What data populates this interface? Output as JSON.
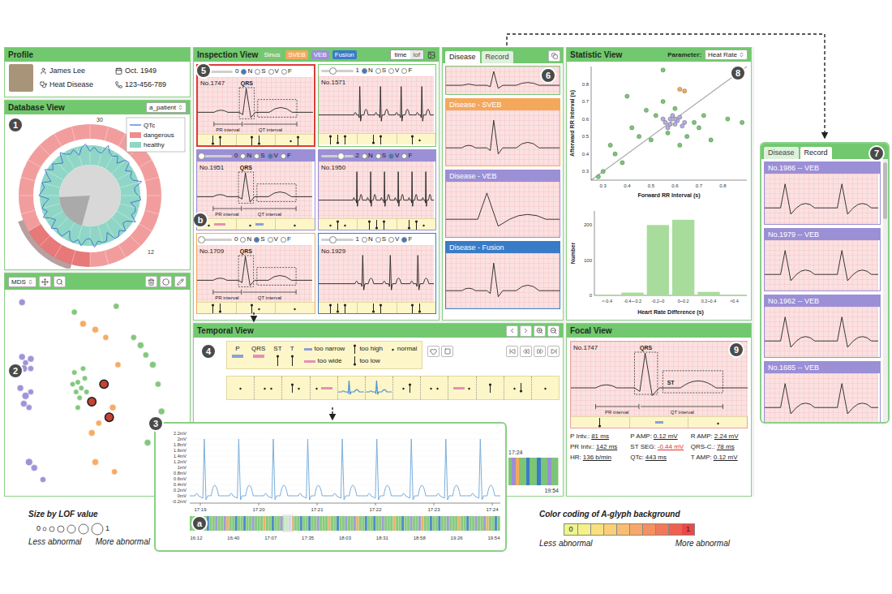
{
  "profile": {
    "title": "Profile",
    "name": "James Lee",
    "birth": "Oct. 1949",
    "disease": "Heat Disease",
    "phone": "123-456-789"
  },
  "database": {
    "title": "Database View",
    "badge": "1",
    "select": "a_patient",
    "legend": [
      {
        "label": "QTc",
        "color": "#3b6fd1"
      },
      {
        "label": "dangerous",
        "color": "#f08c8c"
      },
      {
        "label": "healthy",
        "color": "#8fd6c6"
      }
    ],
    "ticks": [
      "30",
      "12"
    ]
  },
  "projection": {
    "badge": "2",
    "select": "MDS",
    "points": [
      [
        8,
        32,
        0.5,
        "#9b8fd6"
      ],
      [
        10,
        35,
        0.4,
        "#9b8fd6"
      ],
      [
        13,
        33,
        0.5,
        "#9b8fd6"
      ],
      [
        9,
        38,
        0.6,
        "#9b8fd6"
      ],
      [
        13,
        38,
        0.4,
        "#9b8fd6"
      ],
      [
        7,
        48,
        0.5,
        "#9b8fd6"
      ],
      [
        10,
        52,
        0.6,
        "#9b8fd6"
      ],
      [
        13,
        50,
        0.4,
        "#9b8fd6"
      ],
      [
        9,
        56,
        0.5,
        "#9b8fd6"
      ],
      [
        12,
        58,
        0.4,
        "#9b8fd6"
      ],
      [
        12,
        86,
        0.6,
        "#9b8fd6"
      ],
      [
        15,
        89,
        0.5,
        "#9b8fd6"
      ],
      [
        20,
        95,
        0.4,
        "#9b8fd6"
      ],
      [
        8,
        4,
        0.5,
        "#9b8fd6"
      ],
      [
        38,
        40,
        0.3,
        "#7cc576"
      ],
      [
        40,
        45,
        0.3,
        "#7cc576"
      ],
      [
        42,
        48,
        0.3,
        "#7cc576"
      ],
      [
        39,
        50,
        0.3,
        "#7cc576"
      ],
      [
        44,
        43,
        0.3,
        "#7cc576"
      ],
      [
        41,
        53,
        0.3,
        "#7cc576"
      ],
      [
        37,
        46,
        0.3,
        "#7cc576"
      ],
      [
        43,
        38,
        0.3,
        "#7cc576"
      ],
      [
        45,
        50,
        0.3,
        "#7cc576"
      ],
      [
        40,
        58,
        0.3,
        "#7cc576"
      ],
      [
        72,
        22,
        0.4,
        "#7cc576"
      ],
      [
        76,
        26,
        0.5,
        "#7cc576"
      ],
      [
        79,
        31,
        0.4,
        "#7cc576"
      ],
      [
        83,
        36,
        0.5,
        "#7cc576"
      ],
      [
        86,
        46,
        0.4,
        "#7cc576"
      ],
      [
        88,
        60,
        0.5,
        "#7cc576"
      ],
      [
        85,
        69,
        0.4,
        "#7cc576"
      ],
      [
        80,
        76,
        0.5,
        "#7cc576"
      ],
      [
        62,
        6,
        0.4,
        "#7cc576"
      ],
      [
        38,
        9,
        0.4,
        "#7cc576"
      ],
      [
        43,
        15,
        0.5,
        "#f5a85c"
      ],
      [
        50,
        18,
        0.5,
        "#f5a85c"
      ],
      [
        56,
        22,
        0.4,
        "#f5a85c"
      ],
      [
        60,
        58,
        0.5,
        "#f5a85c"
      ],
      [
        52,
        66,
        0.4,
        "#f5a85c"
      ],
      [
        48,
        71,
        0.5,
        "#f5a85c"
      ],
      [
        63,
        36,
        0.4,
        "#f5a85c"
      ],
      [
        50,
        86,
        0.5,
        "#f5a85c"
      ],
      [
        61,
        91,
        0.4,
        "#f5a85c"
      ],
      [
        55,
        46,
        0.8,
        "#c0392b"
      ],
      [
        48,
        55,
        0.8,
        "#c0392b"
      ],
      [
        58,
        63,
        0.8,
        "#c0392b"
      ]
    ]
  },
  "inspection": {
    "title": "Inspection View",
    "badge": "5",
    "glyph_badge": "b",
    "tags": [
      {
        "label": "Sinus",
        "color": "#7cc576"
      },
      {
        "label": "SVEB",
        "color": "#f5a85c"
      },
      {
        "label": "VEB",
        "color": "#9b8fd6"
      },
      {
        "label": "Fusion",
        "color": "#3a7bc8"
      }
    ],
    "modes": [
      {
        "label": "time",
        "selected": true
      },
      {
        "label": "lof",
        "selected": false
      }
    ],
    "classes": [
      "N",
      "S",
      "V",
      "F"
    ],
    "cards": [
      {
        "id": "No.1747",
        "value": "0",
        "level": 0.06,
        "class": "N",
        "border": "#e03a3a",
        "header": "#ffffff",
        "wave": "normal",
        "beats": 1,
        "labels": [
          "QRS",
          "PR interval",
          "QT interval"
        ],
        "glyphs": [
          [
            "low",
            "high"
          ],
          [
            "high",
            "low"
          ],
          [
            "normal",
            "high"
          ]
        ],
        "focused": true
      },
      {
        "id": "No.1571",
        "value": "1",
        "level": 0.35,
        "class": "N",
        "border": "#7cc576",
        "header": "#ffffff",
        "wave": "normal",
        "beats": 4,
        "labels": [],
        "glyphs": [
          [
            "high",
            "low",
            "high"
          ],
          [
            "low",
            "high"
          ],
          [
            "high",
            "normal"
          ]
        ],
        "focused": false
      },
      {
        "id": "No.1951",
        "value": "0",
        "level": 0.06,
        "class": "V",
        "border": "#9b8fd6",
        "header": "#9b8fd6",
        "wave": "normal",
        "beats": 1,
        "labels": [
          "QRS",
          "PR interval",
          "QT interval"
        ],
        "glyphs": [
          [
            "normal",
            "wide"
          ],
          [
            "normal",
            "narrow"
          ],
          [
            "normal"
          ]
        ],
        "focused": false
      },
      {
        "id": "No.1950",
        "value": "2",
        "level": 0.62,
        "class": "V",
        "border": "#9b8fd6",
        "header": "#9b8fd6",
        "wave": "normal",
        "beats": 6,
        "labels": [],
        "glyphs": [
          [
            "normal",
            "high",
            "normal"
          ],
          [
            "high",
            "low",
            "high"
          ],
          [
            "low",
            "high",
            "normal"
          ]
        ],
        "focused": false
      },
      {
        "id": "No.1709",
        "value": "0",
        "level": 0.06,
        "class": "S",
        "border": "#f5a85c",
        "header": "#ffffff",
        "wave": "normal",
        "beats": 1,
        "labels": [
          "QRS",
          "PR interval",
          "QT interval"
        ],
        "glyphs": [
          [
            "high",
            "low"
          ],
          [
            "high",
            "normal"
          ],
          [
            "normal"
          ]
        ],
        "focused": false
      },
      {
        "id": "No.1929",
        "value": "1",
        "level": 0.35,
        "class": "F",
        "border": "#3a7bc8",
        "header": "#ffffff",
        "wave": "normal",
        "beats": 3,
        "labels": [],
        "glyphs": [
          [
            "high",
            "low",
            "high"
          ],
          [
            "low",
            "high"
          ],
          [
            "high",
            "low"
          ]
        ],
        "focused": false
      }
    ]
  },
  "disease": {
    "badge": "6",
    "tabs": [
      {
        "label": "Disease",
        "selected": true
      },
      {
        "label": "Record",
        "selected": false
      }
    ],
    "clipped": {
      "color": "#7cc576",
      "wave": "normal"
    },
    "items": [
      {
        "label": "Disease - SVEB",
        "color": "#f5a85c",
        "wave": "normal"
      },
      {
        "label": "Disease - VEB",
        "color": "#9b8fd6",
        "wave": "veb"
      },
      {
        "label": "Disease - Fusion",
        "color": "#3a7bc8",
        "wave": "normal"
      }
    ]
  },
  "statistic": {
    "title": "Statistic View",
    "badge": "8",
    "param_label": "Parameter:",
    "param": "Heat Rate",
    "scatter": {
      "x_title": "Forward RR Interval (s)",
      "y_title": "Afterward RR Interval (s)",
      "x_ticks": [
        "0.3",
        "0.4",
        "0.5",
        "0.6",
        "0.7",
        "0.8"
      ],
      "y_ticks": [
        "0.3",
        "0.4",
        "0.5",
        "0.6",
        "0.7",
        "0.8"
      ],
      "points": [
        [
          0.28,
          0.27,
          "#7cc576"
        ],
        [
          0.3,
          0.3,
          "#7cc576"
        ],
        [
          0.33,
          0.45,
          "#7cc576"
        ],
        [
          0.35,
          0.4,
          "#7cc576"
        ],
        [
          0.4,
          0.73,
          "#7cc576"
        ],
        [
          0.42,
          0.55,
          "#7cc576"
        ],
        [
          0.45,
          0.5,
          "#7cc576"
        ],
        [
          0.48,
          0.65,
          "#7cc576"
        ],
        [
          0.5,
          0.48,
          "#7cc576"
        ],
        [
          0.52,
          0.62,
          "#7cc576"
        ],
        [
          0.55,
          0.7,
          "#7cc576"
        ],
        [
          0.57,
          0.52,
          "#7cc576"
        ],
        [
          0.62,
          0.45,
          "#7cc576"
        ],
        [
          0.65,
          0.5,
          "#7cc576"
        ],
        [
          0.68,
          0.58,
          "#7cc576"
        ],
        [
          0.7,
          0.55,
          "#7cc576"
        ],
        [
          0.72,
          0.62,
          "#7cc576"
        ],
        [
          0.75,
          0.48,
          "#7cc576"
        ],
        [
          0.82,
          0.6,
          "#7cc576"
        ],
        [
          0.88,
          0.58,
          "#7cc576"
        ],
        [
          0.55,
          0.88,
          "#7cc576"
        ],
        [
          0.38,
          0.35,
          "#7cc576"
        ],
        [
          0.6,
          0.66,
          "#7cc576"
        ],
        [
          0.56,
          0.58,
          "#b9a8e6"
        ],
        [
          0.58,
          0.6,
          "#b9a8e6"
        ],
        [
          0.6,
          0.57,
          "#b9a8e6"
        ],
        [
          0.59,
          0.62,
          "#b9a8e6"
        ],
        [
          0.61,
          0.59,
          "#b9a8e6"
        ],
        [
          0.57,
          0.55,
          "#b9a8e6"
        ],
        [
          0.62,
          0.61,
          "#b9a8e6"
        ],
        [
          0.63,
          0.56,
          "#b9a8e6"
        ],
        [
          0.6,
          0.6,
          "#b9a8e6"
        ],
        [
          0.58,
          0.57,
          "#b9a8e6"
        ],
        [
          0.55,
          0.6,
          "#b9a8e6"
        ],
        [
          0.64,
          0.58,
          "#b9a8e6"
        ],
        [
          0.62,
          0.77,
          "#f5a85c"
        ],
        [
          0.64,
          0.76,
          "#f5a85c"
        ]
      ]
    },
    "histogram": {
      "x_title": "Heart Rate Difference (s)",
      "y_title": "Number",
      "y_ticks": [
        "0",
        "100",
        "200"
      ],
      "categories": [
        "<-0.4",
        "-0.4~-0.2",
        "-0.2~0",
        "0~0.2",
        "0.2~0.4",
        ">0.4"
      ],
      "values": [
        2,
        8,
        200,
        215,
        10,
        2
      ],
      "color": "#a8dc9c"
    }
  },
  "temporal": {
    "title": "Temporal View",
    "badge": "4",
    "parts": [
      {
        "label": "P",
        "kind": "bar",
        "color": "#8aa0d8"
      },
      {
        "label": "QRS",
        "kind": "bar",
        "color": "#e58fb8"
      },
      {
        "label": "ST",
        "kind": "high",
        "color": "#222222"
      },
      {
        "label": "T",
        "kind": "high",
        "color": "#222222"
      }
    ],
    "marks": [
      {
        "label": "too narrow",
        "kind": "narrow"
      },
      {
        "label": "too wide",
        "kind": "wide"
      },
      {
        "label": "too high",
        "kind": "high"
      },
      {
        "label": "too low",
        "kind": "low"
      },
      {
        "label": "normal",
        "kind": "normal"
      }
    ],
    "strip": [
      {
        "marks": [
          "normal"
        ],
        "highlighted": false
      },
      {
        "marks": [
          "normal",
          "normal"
        ],
        "highlighted": false
      },
      {
        "marks": [
          "high",
          "normal"
        ],
        "highlighted": false
      },
      {
        "marks": [
          "normal",
          "wide"
        ],
        "highlighted": false
      },
      {
        "marks": [],
        "highlighted": true
      },
      {
        "marks": [],
        "highlighted": true
      },
      {
        "marks": [
          "normal",
          "high"
        ],
        "highlighted": false
      },
      {
        "marks": [
          "normal",
          "normal"
        ],
        "highlighted": false
      },
      {
        "marks": [
          "wide",
          "normal"
        ],
        "highlighted": false
      },
      {
        "marks": [
          "high"
        ],
        "highlighted": false
      },
      {
        "marks": [
          "normal",
          "low"
        ],
        "highlighted": false
      },
      {
        "marks": [
          "normal"
        ],
        "highlighted": false
      }
    ],
    "hidden_ticks": [
      "17:24",
      "19:54"
    ]
  },
  "zoom": {
    "badge": "3",
    "overview_badge": "a",
    "y_ticks": [
      "2.2mV",
      "2mV",
      "1.8mV",
      "1.6mV",
      "1.4mV",
      "1.2mV",
      "1mV",
      "0.8mV",
      "0.6mV",
      "0.4mV",
      "0.2mV",
      "0mV",
      "-0.2mV"
    ],
    "x_ticks": [
      "17:19",
      "17:20",
      "17:21",
      "17:22",
      "17:23",
      "17:24"
    ],
    "overview_ticks": [
      "16:12",
      "16:40",
      "17:07",
      "17:35",
      "18:03",
      "18:31",
      "18:58",
      "19:26",
      "19:54"
    ],
    "beats": 9,
    "overview_window": 0.3
  },
  "focal": {
    "title": "Focal View",
    "badge": "9",
    "id": "No.1747",
    "labels": [
      "QRS",
      "PR interval",
      "QT interval",
      "ST"
    ],
    "glyphs": [
      [
        "low"
      ],
      [
        "narrow"
      ],
      [
        "normal"
      ]
    ],
    "metrics": [
      {
        "label": "P Intv.:",
        "value": "81 ms",
        "alert": false
      },
      {
        "label": "P AMP:",
        "value": "0.12 mV",
        "alert": false
      },
      {
        "label": "R AMP:",
        "value": "2.24 mV",
        "alert": false
      },
      {
        "label": "PR Intv.:",
        "value": "142 ms",
        "alert": false
      },
      {
        "label": "ST SEG:",
        "value": "-0.44 mV",
        "alert": true
      },
      {
        "label": "QRS-C.:",
        "value": "78 ms",
        "alert": false
      },
      {
        "label": "HR:",
        "value": "136 b/min",
        "alert": false
      },
      {
        "label": "QTc:",
        "value": "443 ms",
        "alert": false
      },
      {
        "label": "T AMP:",
        "value": "0.12 mV",
        "alert": false
      }
    ]
  },
  "record": {
    "badge": "7",
    "tabs": [
      {
        "label": "Disease",
        "selected": false
      },
      {
        "label": "Record",
        "selected": true
      }
    ],
    "items": [
      {
        "label": "No.1986 -- VEB",
        "color": "#9b8fd6",
        "wave": "veb"
      },
      {
        "label": "No.1979 -- VEB",
        "color": "#9b8fd6",
        "wave": "veb"
      },
      {
        "label": "No.1962 -- VEB",
        "color": "#9b8fd6",
        "wave": "veb"
      },
      {
        "label": "No.1685 -- VEB",
        "color": "#9b8fd6",
        "wave": "veb"
      }
    ]
  },
  "legends": {
    "size": {
      "title": "Size by LOF value",
      "min": "0",
      "max": "1",
      "low": "Less abnormal",
      "high": "More abnormal",
      "circles": [
        2,
        3,
        4,
        5,
        6,
        7
      ]
    },
    "color": {
      "title": "Color coding of A-glyph background",
      "min": "0",
      "max": "1",
      "low": "Less abnormal",
      "high": "More abnormal",
      "colors": [
        "#eef58a",
        "#f5f08a",
        "#f8e080",
        "#f9cf78",
        "#f8bd70",
        "#f7a868",
        "#f59160",
        "#f27858",
        "#ef6050",
        "#ec4848"
      ]
    }
  }
}
